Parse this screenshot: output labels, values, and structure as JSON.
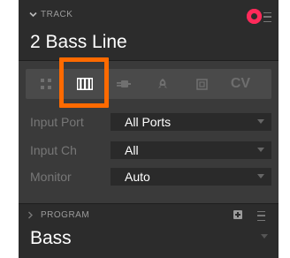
{
  "track": {
    "section_label": "TRACK",
    "name": "2 Bass Line"
  },
  "tabs": [
    {
      "id": "grid",
      "icon": "grid-icon",
      "selected": false
    },
    {
      "id": "keyboard",
      "icon": "keyboard-icon",
      "selected": true
    },
    {
      "id": "plugin",
      "icon": "plug-icon",
      "selected": false
    },
    {
      "id": "audio",
      "icon": "rocket-icon",
      "selected": false
    },
    {
      "id": "macro",
      "icon": "box-icon",
      "selected": false
    },
    {
      "id": "cv",
      "label": "CV",
      "selected": false
    }
  ],
  "settings": {
    "input_port": {
      "label": "Input Port",
      "value": "All Ports"
    },
    "input_ch": {
      "label": "Input Ch",
      "value": "All"
    },
    "monitor": {
      "label": "Monitor",
      "value": "Auto"
    }
  },
  "program": {
    "section_label": "PROGRAM",
    "name": "Bass"
  },
  "colors": {
    "record": "#ff2a5a",
    "highlight": "#ff6a00"
  }
}
